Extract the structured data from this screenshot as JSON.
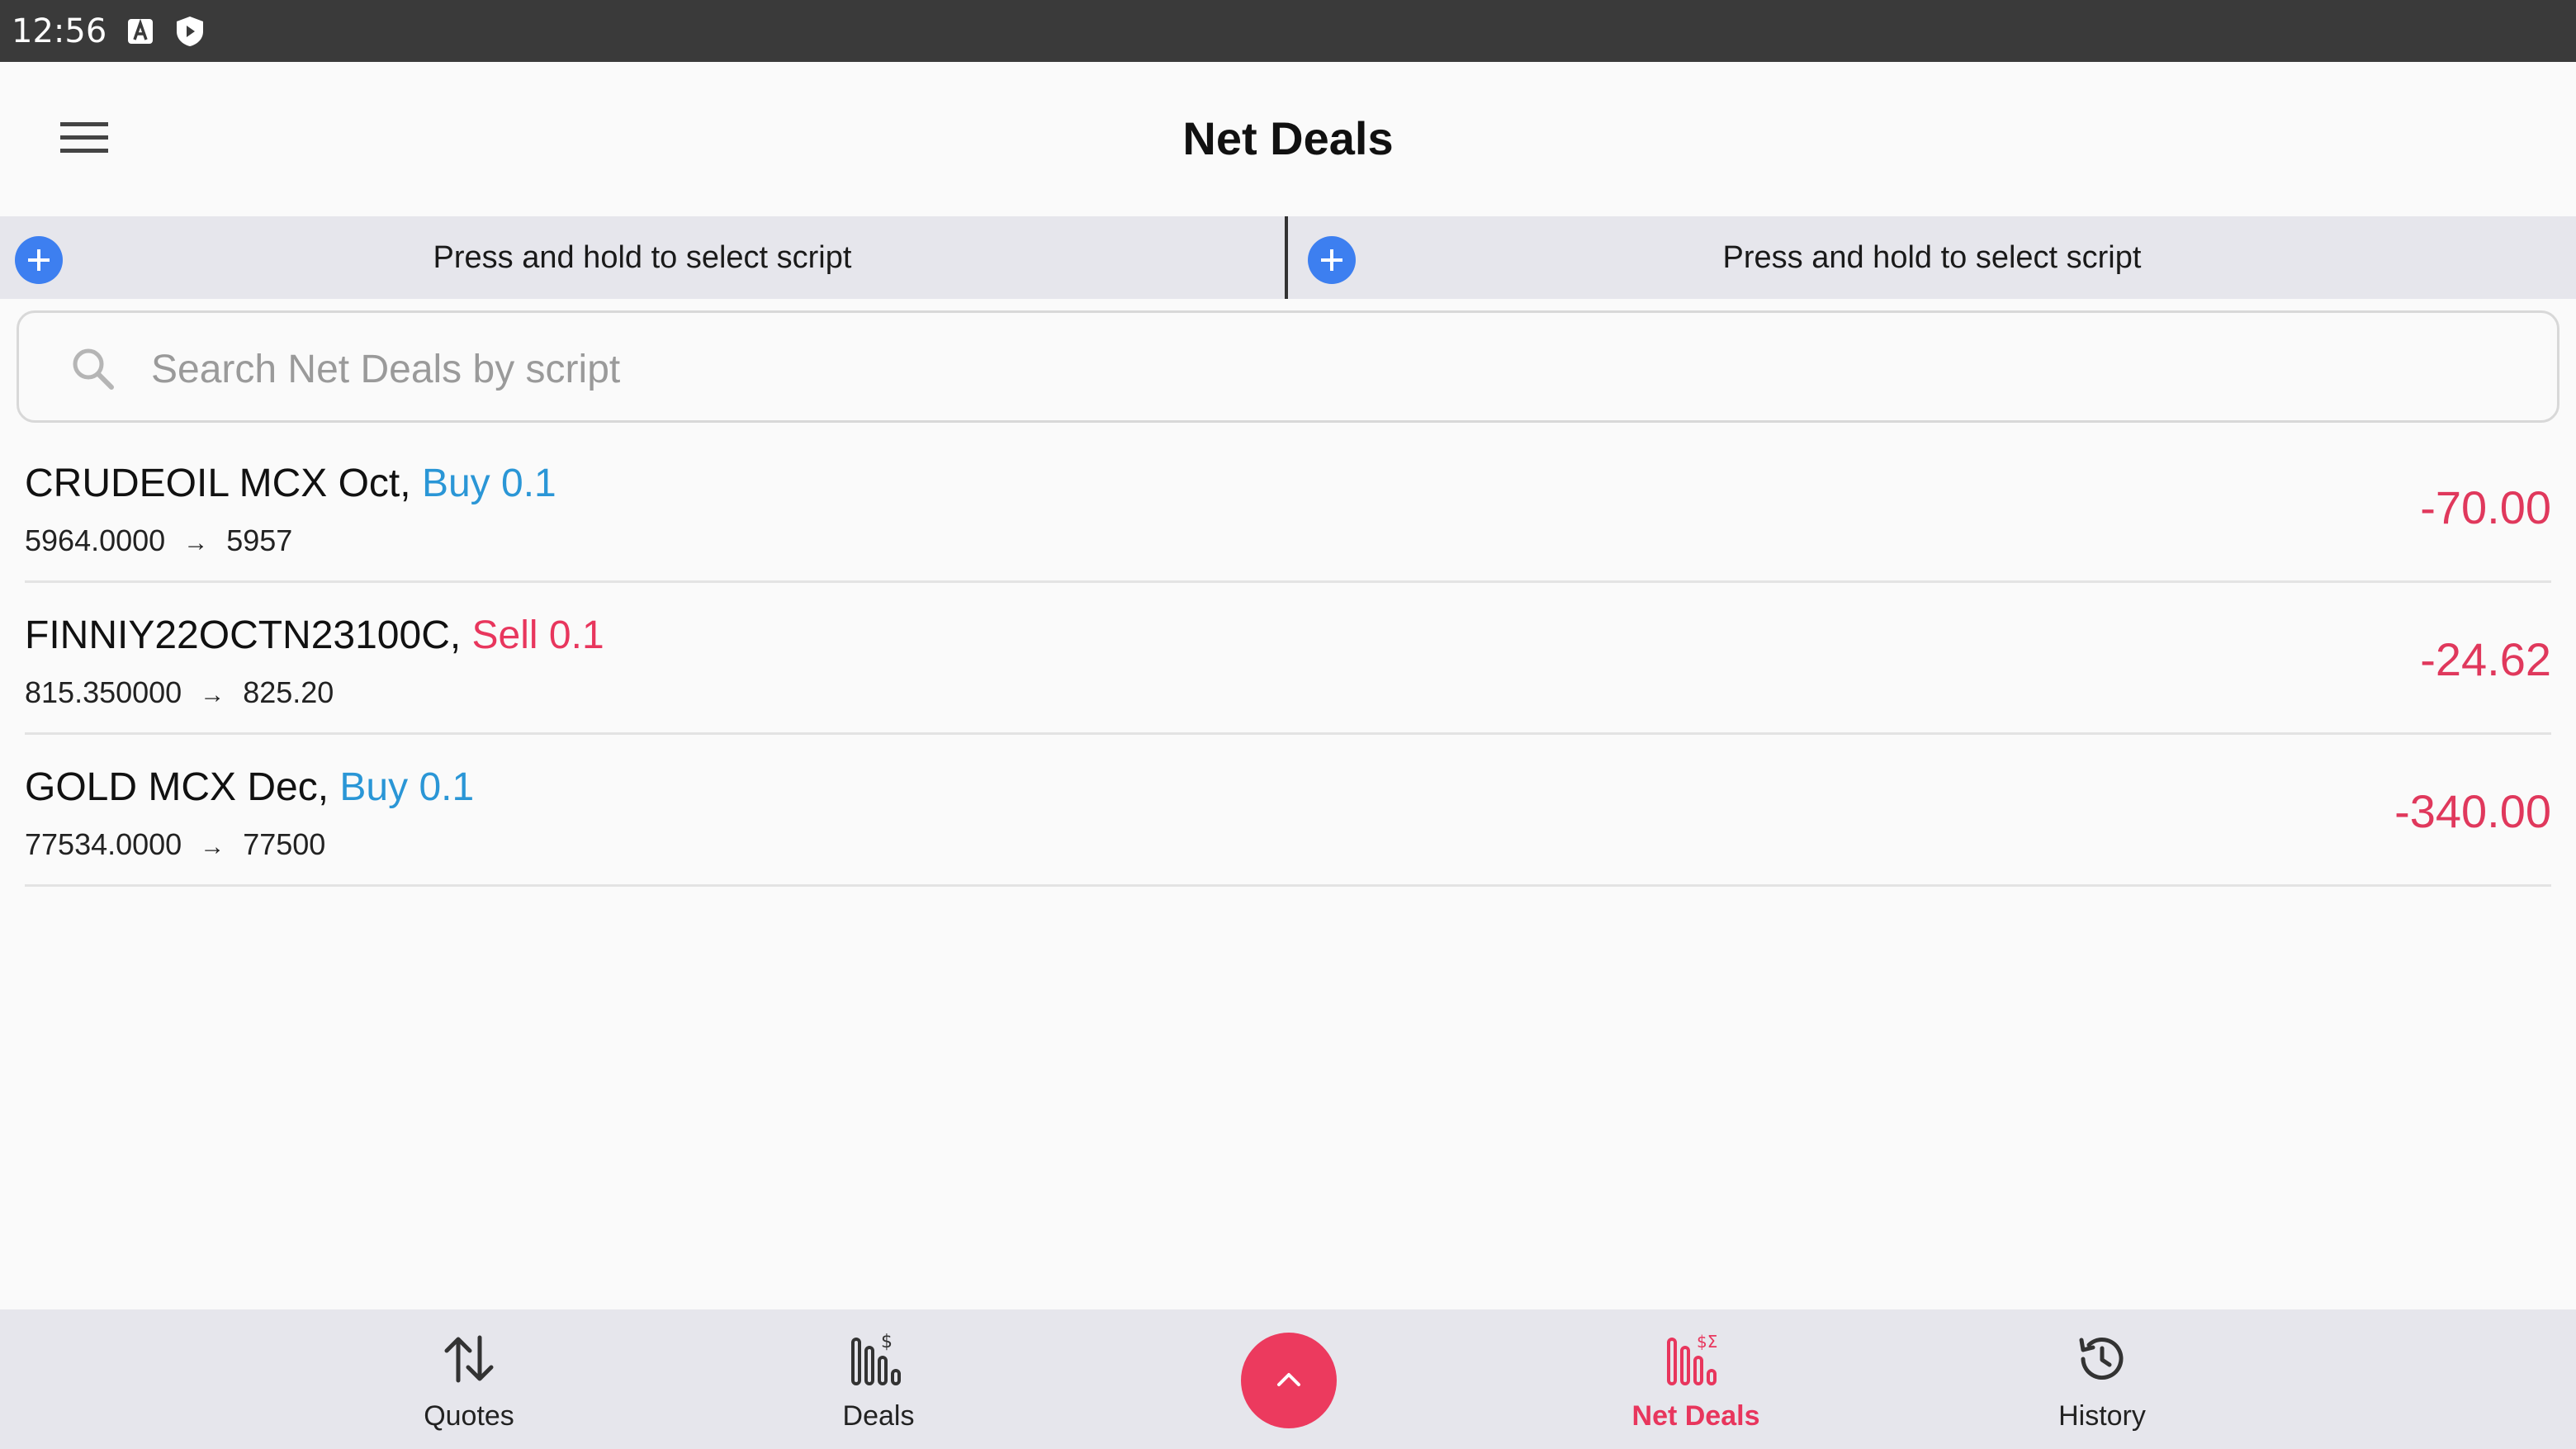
{
  "status_bar": {
    "time": "12:56",
    "icons": [
      "keyboard-a-icon",
      "shield-icon"
    ]
  },
  "app_bar": {
    "title": "Net Deals",
    "menu_icon": "hamburger-menu-icon"
  },
  "script_selectors": [
    {
      "label": "Press and hold to select script",
      "icon": "add-circle-icon"
    },
    {
      "label": "Press and hold to select script",
      "icon": "add-circle-icon"
    }
  ],
  "search": {
    "placeholder": "Search Net Deals by script",
    "value": ""
  },
  "deals": [
    {
      "symbol": "CRUDEOIL MCX Oct,",
      "side": "Buy 0.1",
      "side_type": "buy",
      "open_price": "5964.0000",
      "arrow": "→",
      "current_price": "5957",
      "pnl": "-70.00"
    },
    {
      "symbol": "FINNIY22OCTN23100C,",
      "side": "Sell 0.1",
      "side_type": "sell",
      "open_price": "815.350000",
      "arrow": "→",
      "current_price": "825.20",
      "pnl": "-24.62"
    },
    {
      "symbol": "GOLD MCX Dec,",
      "side": "Buy 0.1",
      "side_type": "buy",
      "open_price": "77534.0000",
      "arrow": "→",
      "current_price": "77500",
      "pnl": "-340.00"
    }
  ],
  "bottom_nav": {
    "items": [
      {
        "label": "Quotes",
        "icon": "arrows-up-down-icon",
        "active": false
      },
      {
        "label": "Deals",
        "icon": "deals-chart-icon",
        "active": false
      },
      {
        "label": "Net Deals",
        "icon": "net-deals-chart-icon",
        "active": true
      },
      {
        "label": "History",
        "icon": "history-clock-icon",
        "active": false
      }
    ],
    "fab_icon": "chevron-up-icon"
  },
  "colors": {
    "accent": "#ec3a5e",
    "buy": "#2a96d6",
    "sell": "#e8365d",
    "pnl_negative": "#e0385c",
    "add_button": "#3d7ff0"
  }
}
